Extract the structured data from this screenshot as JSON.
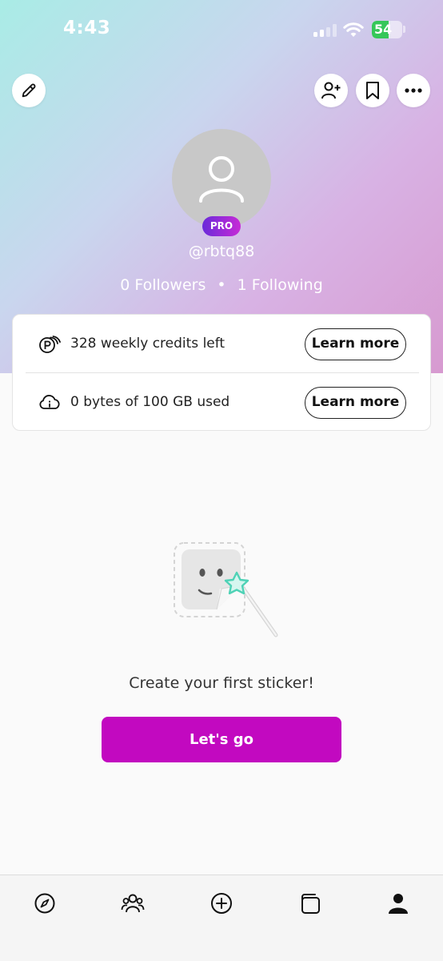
{
  "status_bar": {
    "time": "4:43",
    "battery": "54",
    "battery_level": 0.54
  },
  "profile": {
    "username": "@rbtq88",
    "badge": "PRO",
    "followers": "0 Followers",
    "separator": "•",
    "following": "1 Following"
  },
  "header_icons": {
    "left": "edit-pencil-icon",
    "right": [
      "add-user-icon",
      "bookmark-icon",
      "more-icon"
    ]
  },
  "usage": [
    {
      "icon": "credits-icon",
      "label": "328 weekly credits left",
      "button": "Learn more"
    },
    {
      "icon": "cloud-info-icon",
      "label": "0 bytes of 100 GB used",
      "button": "Learn more"
    }
  ],
  "empty_state": {
    "message": "Create your first sticker!",
    "cta": "Let's go"
  },
  "tab_bar": {
    "items": [
      "explore-icon",
      "community-icon",
      "create-icon",
      "library-icon",
      "profile-icon"
    ],
    "active": "profile-icon"
  },
  "colors": {
    "accent": "#c209c0",
    "pro_badge_start": "#6a2bd9",
    "pro_badge_end": "#c72bd6",
    "gradient_start": "#a9ece6",
    "gradient_end": "#d79ad0"
  }
}
